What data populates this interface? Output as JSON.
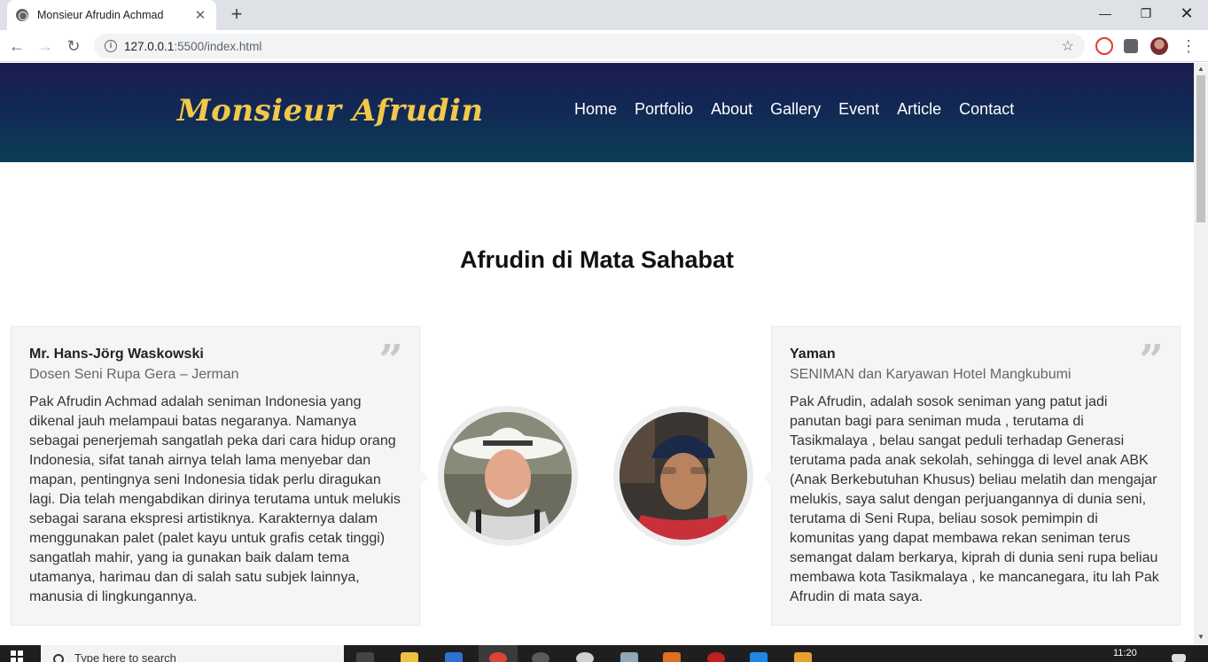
{
  "browser": {
    "tab_title": "Monsieur Afrudin Achmad",
    "new_tab": "+",
    "url_host": "127.0.0.1",
    "url_rest": ":5500/index.html"
  },
  "site": {
    "brand": "Monsieur Afrudin",
    "nav": [
      "Home",
      "Portfolio",
      "About",
      "Gallery",
      "Event",
      "Article",
      "Contact"
    ],
    "section_title": "Afrudin di Mata Sahabat"
  },
  "testimonials": [
    {
      "name": "Mr. Hans-Jörg Waskowski",
      "role": "Dosen Seni Rupa Gera – Jerman",
      "text": "Pak Afrudin Achmad adalah seniman Indonesia yang dikenal jauh melampaui batas negaranya. Namanya sebagai penerjemah sangatlah peka dari cara hidup orang Indonesia, sifat tanah airnya telah lama menyebar dan mapan, pentingnya seni Indonesia tidak perlu diragukan lagi. Dia telah mengabdikan dirinya terutama untuk melukis sebagai sarana ekspresi artistiknya. Karakternya dalam menggunakan palet (palet kayu untuk grafis cetak tinggi) sangatlah mahir, yang ia gunakan baik dalam tema utamanya, harimau dan di salah satu subjek lainnya, manusia di lingkungannya."
    },
    {
      "name": "Yaman",
      "role": "SENIMAN dan Karyawan Hotel Mangkubumi",
      "text": "Pak Afrudin, adalah sosok seniman yang patut jadi panutan bagi para seniman muda , terutama di Tasikmalaya , belau sangat peduli terhadap Generasi terutama pada anak sekolah, sehingga di level anak ABK (Anak Berkebutuhan Khusus) beliau melatih dan mengajar melukis, saya salut dengan perjuangannya di dunia seni, terutama di Seni Rupa, beliau sosok pemimpin di komunitas yang dapat membawa rekan seniman terus semangat dalam berkarya, kiprah di dunia seni rupa beliau membawa kota Tasikmalaya , ke mancanegara, itu lah Pak Afrudin di mata saya."
    }
  ],
  "taskbar": {
    "search_placeholder": "Type here to search",
    "time": "11:20"
  }
}
